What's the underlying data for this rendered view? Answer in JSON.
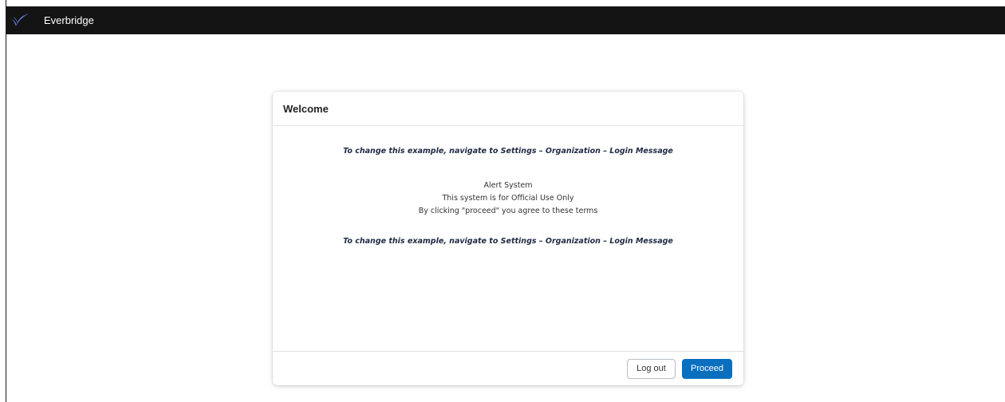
{
  "app": {
    "brand_name": "Everbridge",
    "logo_icon": "everbridge-bird-icon",
    "topbar_color": "#141414",
    "logo_color": "#5b7cf5"
  },
  "modal": {
    "title": "Welcome",
    "instruction_top": "To change this example, navigate to Settings – Organization – Login Message",
    "message_lines": [
      "Alert System",
      "This system is for Official Use Only",
      "By clicking \"proceed\" you agree to these terms"
    ],
    "instruction_bottom": "To change this example, navigate to Settings – Organization – Login Message",
    "buttons": {
      "logout_label": "Log out",
      "proceed_label": "Proceed",
      "proceed_color": "#0b6fbf"
    }
  }
}
